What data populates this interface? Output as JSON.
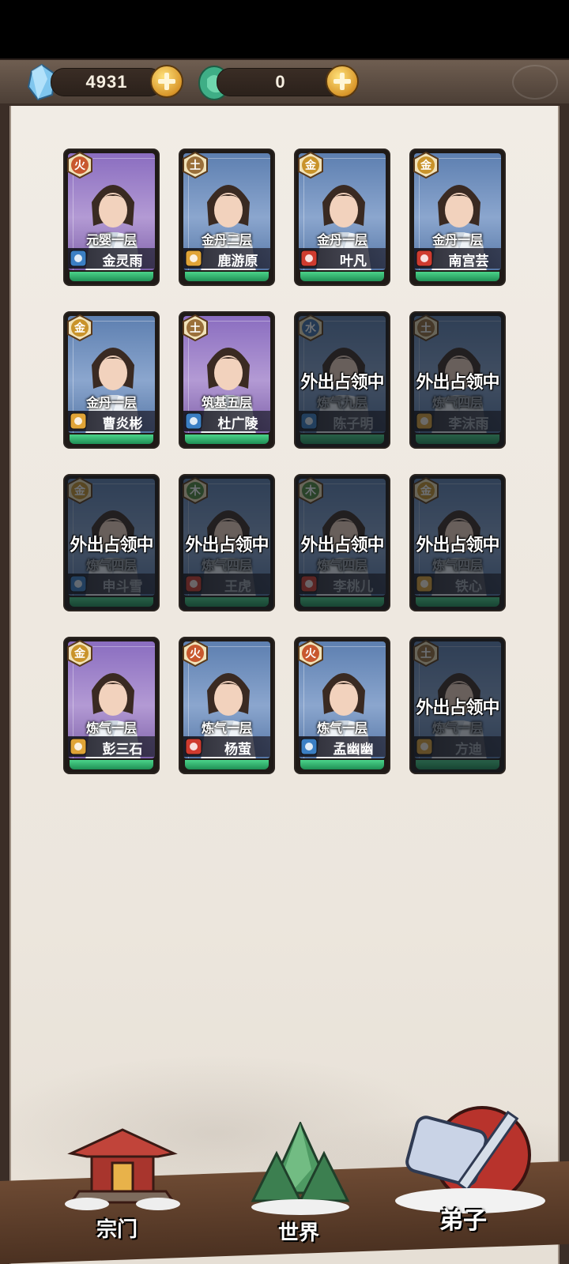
{
  "resources": {
    "crystal": {
      "value": "4931",
      "icon": "crystal-icon",
      "color": "#6fb7e8"
    },
    "jade": {
      "value": "0",
      "icon": "jade-icon",
      "color": "#4fc39a"
    }
  },
  "cards": [
    {
      "element": "火",
      "realm": "元婴一层",
      "name": "金灵雨",
      "sect": "water",
      "bg": "purple",
      "away": false
    },
    {
      "element": "土",
      "realm": "金丹二层",
      "name": "鹿游原",
      "sect": "earth",
      "bg": "blue",
      "away": false
    },
    {
      "element": "金",
      "realm": "金丹一层",
      "name": "叶凡",
      "sect": "fire",
      "bg": "blue",
      "away": false
    },
    {
      "element": "金",
      "realm": "金丹一层",
      "name": "南宫芸",
      "sect": "fire",
      "bg": "blue",
      "away": false
    },
    {
      "element": "金",
      "realm": "金丹一层",
      "name": "曹炎彬",
      "sect": "earth",
      "bg": "blue",
      "away": false
    },
    {
      "element": "土",
      "realm": "筑基五层",
      "name": "杜广陵",
      "sect": "water",
      "bg": "purple",
      "away": false
    },
    {
      "element": "水",
      "realm": "炼气九层",
      "name": "陈子明",
      "sect": "water",
      "bg": "blue",
      "away": true
    },
    {
      "element": "土",
      "realm": "炼气四层",
      "name": "李沫雨",
      "sect": "earth",
      "bg": "blue",
      "away": true
    },
    {
      "element": "金",
      "realm": "炼气四层",
      "name": "申斗雪",
      "sect": "water",
      "bg": "blue",
      "away": true
    },
    {
      "element": "木",
      "realm": "炼气四层",
      "name": "王虎",
      "sect": "fire",
      "bg": "blue",
      "away": true
    },
    {
      "element": "木",
      "realm": "炼气四层",
      "name": "李桃儿",
      "sect": "fire",
      "bg": "blue",
      "away": true
    },
    {
      "element": "金",
      "realm": "炼气四层",
      "name": "铁心",
      "sect": "earth",
      "bg": "blue",
      "away": true
    },
    {
      "element": "金",
      "realm": "炼气一层",
      "name": "彭三石",
      "sect": "earth",
      "bg": "purple",
      "away": false
    },
    {
      "element": "火",
      "realm": "炼气一层",
      "name": "杨萤",
      "sect": "fire",
      "bg": "blue",
      "away": false
    },
    {
      "element": "火",
      "realm": "炼气一层",
      "name": "孟幽幽",
      "sect": "water",
      "bg": "blue",
      "away": false
    },
    {
      "element": "土",
      "realm": "炼气一层",
      "name": "方迪",
      "sect": "earth",
      "bg": "blue",
      "away": true
    }
  ],
  "away_label": "外出占领中",
  "nav": [
    {
      "label": "宗门",
      "icon": "sect-hall-icon"
    },
    {
      "label": "世界",
      "icon": "mountain-icon"
    },
    {
      "label": "弟子",
      "icon": "disciple-scroll-icon"
    }
  ]
}
